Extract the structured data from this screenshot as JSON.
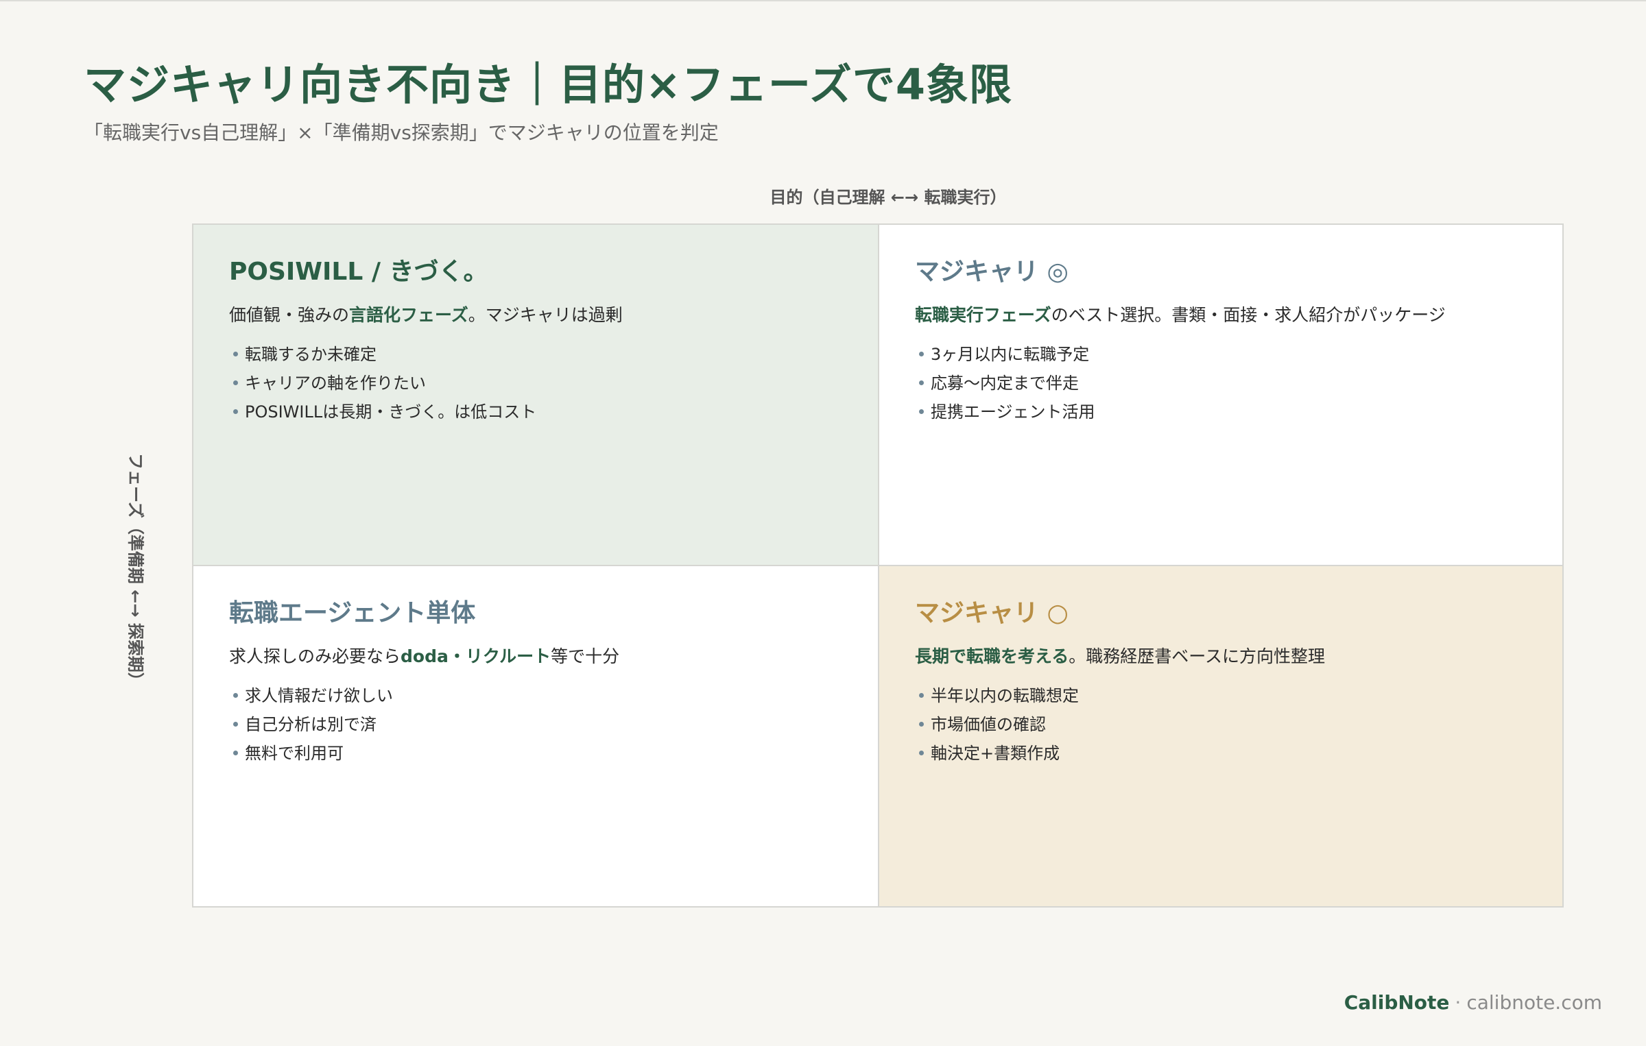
{
  "header": {
    "title": "マジキャリ向き不向き｜目的×フェーズで4象限",
    "subtitle": "「転職実行vs自己理解」×「準備期vs探索期」でマジキャリの位置を判定"
  },
  "axes": {
    "x_label": "目的（自己理解 ←→ 転職実行）",
    "y_label": "フェーズ（準備期 ←→ 探索期）"
  },
  "colors": {
    "title": "#2b5e45",
    "highlight": "#2b5e45",
    "slate": "#5e7a8a",
    "gold": "#b88e44",
    "q_top_left_bg": "#e8eee7",
    "q_bottom_right_bg": "#f4ecdb"
  },
  "quadrants": {
    "top_left": {
      "title": "POSIWILL / きづく。",
      "desc_hl": "言語化フェーズ",
      "desc_pre": "価値観・強みの",
      "desc_post": "。マジキャリは過剰",
      "bullets": [
        "転職するか未確定",
        "キャリアの軸を作りたい",
        "POSIWILLは長期・きづく。は低コスト"
      ]
    },
    "top_right": {
      "title": "マジキャリ ◎",
      "desc_hl": "転職実行フェーズ",
      "desc_post": "のベスト選択。書類・面接・求人紹介がパッケージ",
      "bullets": [
        "3ヶ月以内に転職予定",
        "応募〜内定まで伴走",
        "提携エージェント活用"
      ]
    },
    "bottom_left": {
      "title": "転職エージェント単体",
      "desc_pre": "求人探しのみ必要なら",
      "desc_hl": "doda・リクルート",
      "desc_post": "等で十分",
      "bullets": [
        "求人情報だけ欲しい",
        "自己分析は別で済",
        "無料で利用可"
      ]
    },
    "bottom_right": {
      "title": "マジキャリ ○",
      "desc_hl": "長期で転職を考える",
      "desc_post": "。職務経歴書ベースに方向性整理",
      "bullets": [
        "半年以内の転職想定",
        "市場価値の確認",
        "軸決定+書類作成"
      ]
    }
  },
  "footer": {
    "brand": "CalibNote",
    "separator": "·",
    "site": "calibnote.com"
  }
}
